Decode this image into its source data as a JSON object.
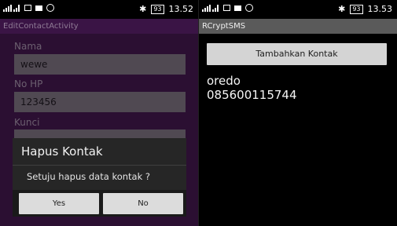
{
  "left": {
    "status": {
      "network": "4G",
      "time": "13.52",
      "battery": "93"
    },
    "title": "EditContactActivity",
    "form": {
      "name_label": "Nama",
      "name_value": "wewe",
      "phone_label": "No HP",
      "phone_value": "123456",
      "key_label": "Kunci"
    },
    "dialog": {
      "title": "Hapus Kontak",
      "message": "Setuju hapus data kontak ?",
      "yes": "Yes",
      "no": "No"
    }
  },
  "right": {
    "status": {
      "network": "4G",
      "time": "13.53",
      "battery": "93"
    },
    "title": "RCryptSMS",
    "add_button": "Tambahkan Kontak",
    "contacts": [
      {
        "name": "oredo",
        "phone": "085600115744"
      }
    ]
  }
}
